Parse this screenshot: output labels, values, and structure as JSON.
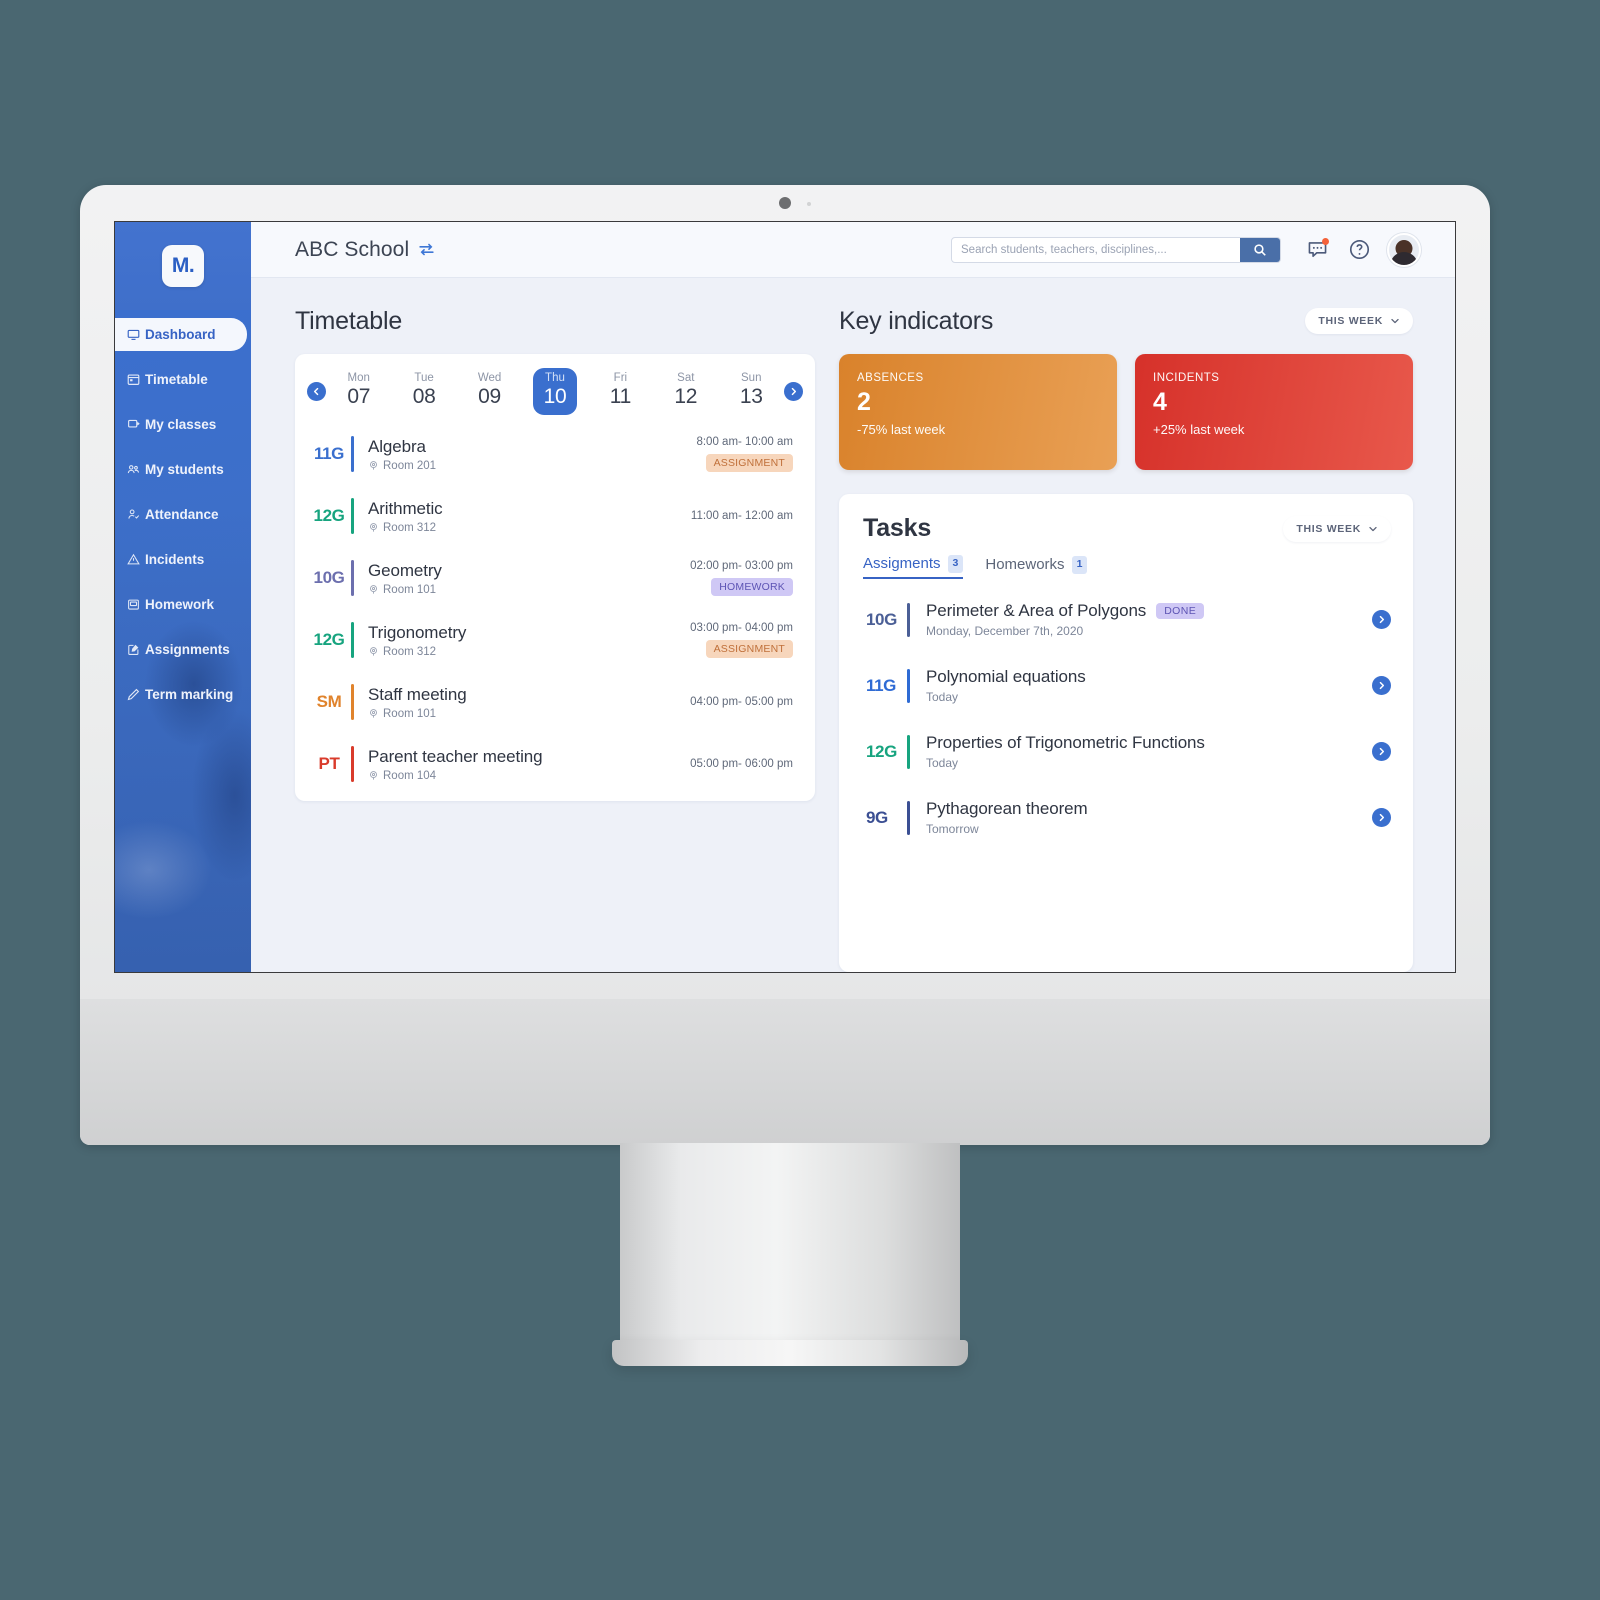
{
  "sidebar": {
    "logo_text": "M.",
    "items": [
      {
        "label": "Dashboard",
        "icon": "monitor-icon",
        "active": true
      },
      {
        "label": "Timetable",
        "icon": "calendar-icon",
        "active": false
      },
      {
        "label": "My classes",
        "icon": "classes-icon",
        "active": false
      },
      {
        "label": "My students",
        "icon": "students-icon",
        "active": false
      },
      {
        "label": "Attendance",
        "icon": "person-check-icon",
        "active": false
      },
      {
        "label": "Incidents",
        "icon": "warning-icon",
        "active": false
      },
      {
        "label": "Homework",
        "icon": "book-icon",
        "active": false
      },
      {
        "label": "Assignments",
        "icon": "edit-doc-icon",
        "active": false
      },
      {
        "label": "Term marking",
        "icon": "pencil-icon",
        "active": false
      }
    ]
  },
  "topbar": {
    "school_name": "ABC School",
    "swap_icon": "swap-horizontal-icon",
    "search_placeholder": "Search students, teachers, disciplines,...",
    "search_value": "",
    "search_icon": "search-icon",
    "messages_icon": "chat-bubble-icon",
    "help_icon": "question-circle-icon",
    "avatar_icon": "user-avatar"
  },
  "timetable": {
    "title": "Timetable",
    "prev_icon": "chevron-left-icon",
    "next_icon": "chevron-right-icon",
    "days": [
      {
        "dow": "Mon",
        "num": "07",
        "selected": false
      },
      {
        "dow": "Tue",
        "num": "08",
        "selected": false
      },
      {
        "dow": "Wed",
        "num": "09",
        "selected": false
      },
      {
        "dow": "Thu",
        "num": "10",
        "selected": true
      },
      {
        "dow": "Fri",
        "num": "11",
        "selected": false
      },
      {
        "dow": "Sat",
        "num": "12",
        "selected": false
      },
      {
        "dow": "Sun",
        "num": "13",
        "selected": false
      }
    ],
    "lessons": [
      {
        "class": "11G",
        "color": "#3a6fce",
        "subject": "Algebra",
        "room": "Room 201",
        "time": "8:00 am- 10:00 am",
        "tag": "ASSIGNMENT",
        "tag_type": "assignment"
      },
      {
        "class": "12G",
        "color": "#17a47f",
        "subject": "Arithmetic",
        "room": "Room 312",
        "time": "11:00 am- 12:00 am",
        "tag": "",
        "tag_type": ""
      },
      {
        "class": "10G",
        "color": "#6c6fae",
        "subject": "Geometry",
        "room": "Room 101",
        "time": "02:00 pm- 03:00 pm",
        "tag": "HOMEWORK",
        "tag_type": "homework"
      },
      {
        "class": "12G",
        "color": "#17a47f",
        "subject": "Trigonometry",
        "room": "Room 312",
        "time": "03:00 pm- 04:00 pm",
        "tag": "ASSIGNMENT",
        "tag_type": "assignment"
      },
      {
        "class": "SM",
        "color": "#e0832c",
        "subject": "Staff meeting",
        "room": "Room 101",
        "time": "04:00 pm- 05:00 pm",
        "tag": "",
        "tag_type": ""
      },
      {
        "class": "PT",
        "color": "#d93b2b",
        "subject": "Parent teacher meeting",
        "room": "Room 104",
        "time": "05:00 pm- 06:00 pm",
        "tag": "",
        "tag_type": ""
      }
    ],
    "room_icon": "location-pin-icon"
  },
  "key_indicators": {
    "title": "Key indicators",
    "range_label": "THIS WEEK",
    "range_icon": "chevron-down-icon",
    "cards": [
      {
        "label": "ABSENCES",
        "value": "2",
        "delta": "-75% last week",
        "color_from": "#d9822b",
        "color_to": "#e8a košice"
      },
      {
        "label": "INCIDENTS",
        "value": "4",
        "delta": "+25% last week",
        "color_from": "#d6312a",
        "color_to": "#e8564a"
      }
    ]
  },
  "tasks": {
    "title": "Tasks",
    "range_label": "THIS WEEK",
    "range_icon": "chevron-down-icon",
    "tabs": [
      {
        "label": "Assigments",
        "count": "3",
        "active": true
      },
      {
        "label": "Homeworks",
        "count": "1",
        "active": false
      }
    ],
    "items": [
      {
        "class": "10G",
        "color": "#4b5f96",
        "title": "Perimeter & Area of Polygons",
        "status": "DONE",
        "sub": "Monday, December 7th, 2020",
        "go_icon": "chevron-right-icon"
      },
      {
        "class": "11G",
        "color": "#2f6bd4",
        "title": "Polynomial equations",
        "status": "",
        "sub": "Today",
        "go_icon": "chevron-right-icon"
      },
      {
        "class": "12G",
        "color": "#17a47f",
        "title": "Properties of Trigonometric Functions",
        "status": "",
        "sub": "Today",
        "go_icon": "chevron-right-icon"
      },
      {
        "class": "9G",
        "color": "#3b4f93",
        "title": "Pythagorean theorem",
        "status": "",
        "sub": "Tomorrow",
        "go_icon": "chevron-right-icon"
      }
    ]
  }
}
